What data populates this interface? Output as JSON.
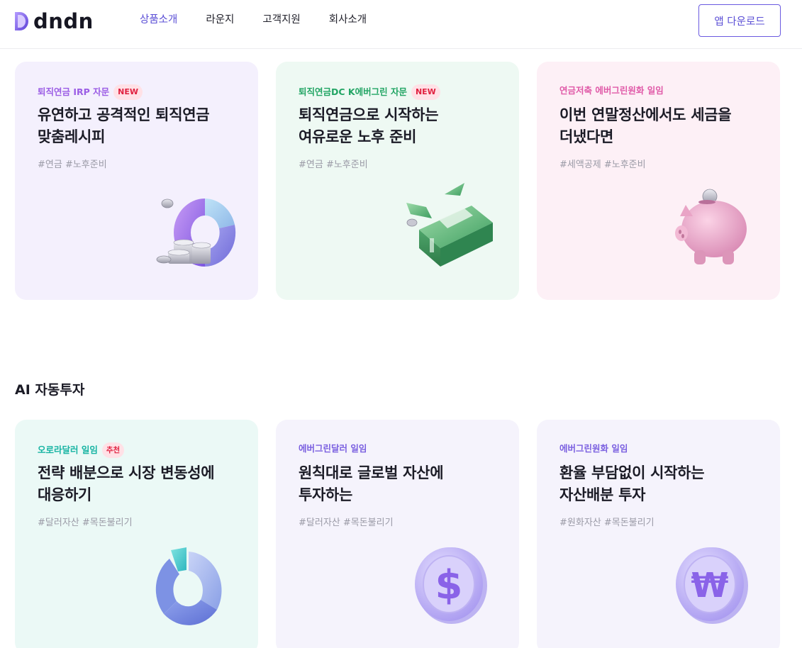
{
  "header": {
    "logo_text": "dndn",
    "nav": [
      "상품소개",
      "라운지",
      "고객지원",
      "회사소개"
    ],
    "download_label": "앱 다운로드"
  },
  "colors": {
    "accent": "#5b4fd6",
    "purple_category": "#9b5de5",
    "green_category": "#22a564",
    "pink_category": "#e05aa8",
    "teal_category": "#17b4a3",
    "violet_category": "#7a5fe0"
  },
  "top_cards": [
    {
      "category": "퇴직연금 IRP 자문",
      "badge": "NEW",
      "title": "유연하고 공격적인 퇴직연금\n맞춤레시피",
      "tags": "#연금 #노후준비",
      "icon": "donut-chart-with-coins-icon"
    },
    {
      "category": "퇴직연금DC K에버그린 자문",
      "badge": "NEW",
      "title": "퇴직연금으로 시작하는\n여유로운 노후 준비",
      "tags": "#연금 #노후준비",
      "icon": "cash-stack-icon"
    },
    {
      "category": "연금저축 에버그린원화 일임",
      "badge": "",
      "title": "이번 연말정산에서도 세금을\n더냈다면",
      "tags": "#세액공제 #노후준비",
      "icon": "piggy-bank-icon"
    }
  ],
  "section_title": "AI 자동투자",
  "bottom_cards": [
    {
      "category": "오로라달러 일임",
      "badge": "추천",
      "title": "전략 배분으로 시장 변동성에\n대응하기",
      "tags": "#달러자산 #목돈불리기",
      "icon": "segmented-donut-icon"
    },
    {
      "category": "에버그린달러 일임",
      "badge": "",
      "title": "원칙대로 글로벌 자산에\n투자하는",
      "tags": "#달러자산 #목돈불리기",
      "icon": "dollar-coin-icon"
    },
    {
      "category": "에버그린원화 일임",
      "badge": "",
      "title": "환율 부담없이 시작하는\n자산배분 투자",
      "tags": "#원화자산 #목돈불리기",
      "icon": "won-coin-icon"
    }
  ]
}
